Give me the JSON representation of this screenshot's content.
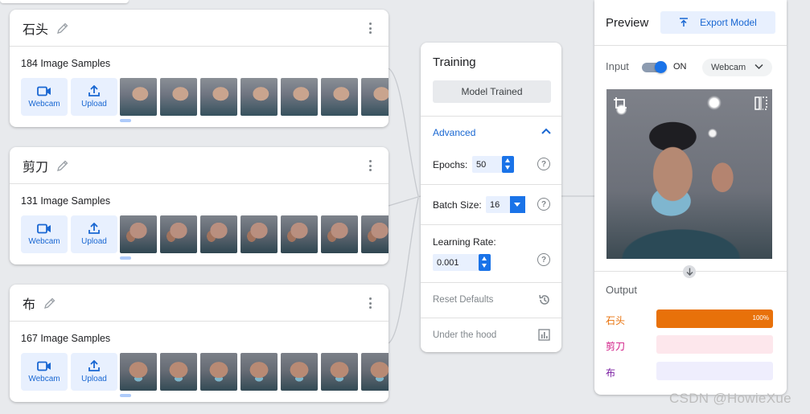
{
  "classes": [
    {
      "name": "石头",
      "samples_label": "184 Image Samples",
      "webcam_label": "Webcam",
      "upload_label": "Upload",
      "thumb_style": "t1"
    },
    {
      "name": "剪刀",
      "samples_label": "131 Image Samples",
      "webcam_label": "Webcam",
      "upload_label": "Upload",
      "thumb_style": "t2"
    },
    {
      "name": "布",
      "samples_label": "167 Image Samples",
      "webcam_label": "Webcam",
      "upload_label": "Upload",
      "thumb_style": "t3"
    }
  ],
  "training": {
    "title": "Training",
    "trained_button": "Model Trained",
    "advanced_label": "Advanced",
    "epochs_label": "Epochs:",
    "epochs_value": "50",
    "batch_label": "Batch Size:",
    "batch_value": "16",
    "lr_label": "Learning Rate:",
    "lr_value": "0.001",
    "help_glyph": "?",
    "reset_label": "Reset Defaults",
    "hood_label": "Under the hood"
  },
  "preview": {
    "title": "Preview",
    "export_label": "Export Model",
    "input_label": "Input",
    "toggle_state": "ON",
    "source_select": "Webcam",
    "output_label": "Output",
    "outputs": [
      {
        "name": "石头",
        "percent": 100,
        "percent_label": "100%",
        "color": "#e8710a",
        "track": "#e8710a"
      },
      {
        "name": "剪刀",
        "percent": 0,
        "percent_label": "",
        "color": "#d01884",
        "track": "#fde7ec"
      },
      {
        "name": "布",
        "percent": 0,
        "percent_label": "",
        "color": "#7b1fa2",
        "track": "#efeefd"
      }
    ]
  },
  "colors": {
    "accent": "#1a73e8",
    "accent_light": "#e8f0fe",
    "background": "#e8eaed"
  },
  "watermark": "CSDN @HowieXue"
}
